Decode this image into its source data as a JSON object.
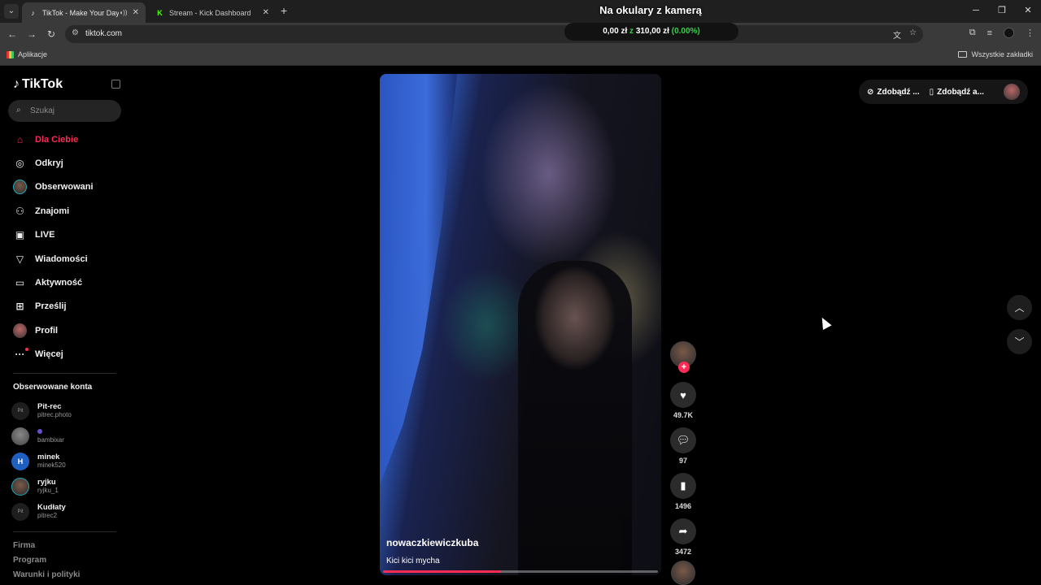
{
  "browser": {
    "tabs": [
      {
        "title": "TikTok - Make Your Day",
        "active": true
      },
      {
        "title": "Stream - Kick Dashboard",
        "active": false
      }
    ],
    "url": "tiktok.com",
    "bookmarks": {
      "apps": "Aplikacje",
      "all": "Wszystkie zakładki"
    }
  },
  "overlay": {
    "title": "Na okulary z kamerą",
    "amount": "0,00 zł",
    "z": "z",
    "goal": "310,00 zł",
    "percent": "(0.00%)"
  },
  "tiktok": {
    "logo": "TikTok",
    "search_placeholder": "Szukaj",
    "nav": [
      {
        "label": "Dla Ciebie",
        "icon": "home-icon"
      },
      {
        "label": "Odkryj",
        "icon": "compass-icon"
      },
      {
        "label": "Obserwowani",
        "icon": "avatar-icon"
      },
      {
        "label": "Znajomi",
        "icon": "people-icon"
      },
      {
        "label": "LIVE",
        "icon": "live-icon"
      },
      {
        "label": "Wiadomości",
        "icon": "send-icon"
      },
      {
        "label": "Aktywność",
        "icon": "activity-icon"
      },
      {
        "label": "Prześlij",
        "icon": "upload-icon"
      },
      {
        "label": "Profil",
        "icon": "profile-icon"
      },
      {
        "label": "Więcej",
        "icon": "more-icon"
      }
    ],
    "following_label": "Obserwowane konta",
    "following": [
      {
        "name": "Pit-rec",
        "handle": "pitrec.photo"
      },
      {
        "name": "",
        "handle": "bambixar"
      },
      {
        "name": "minek",
        "handle": "minek520"
      },
      {
        "name": "ryjku",
        "handle": "ryjku_1"
      },
      {
        "name": "Kudłaty",
        "handle": "pitrec2"
      }
    ],
    "footer": [
      "Firma",
      "Program",
      "Warunki i polityki"
    ],
    "video": {
      "author": "nowaczkiewiczkuba",
      "caption": "Kici kici mycha",
      "progress": 0.43
    },
    "actions": {
      "likes": "49.7K",
      "comments": "97",
      "saves": "1496",
      "shares": "3472"
    },
    "top_right": {
      "coins": "Zdobądź ...",
      "app": "Zdobądź a..."
    }
  }
}
